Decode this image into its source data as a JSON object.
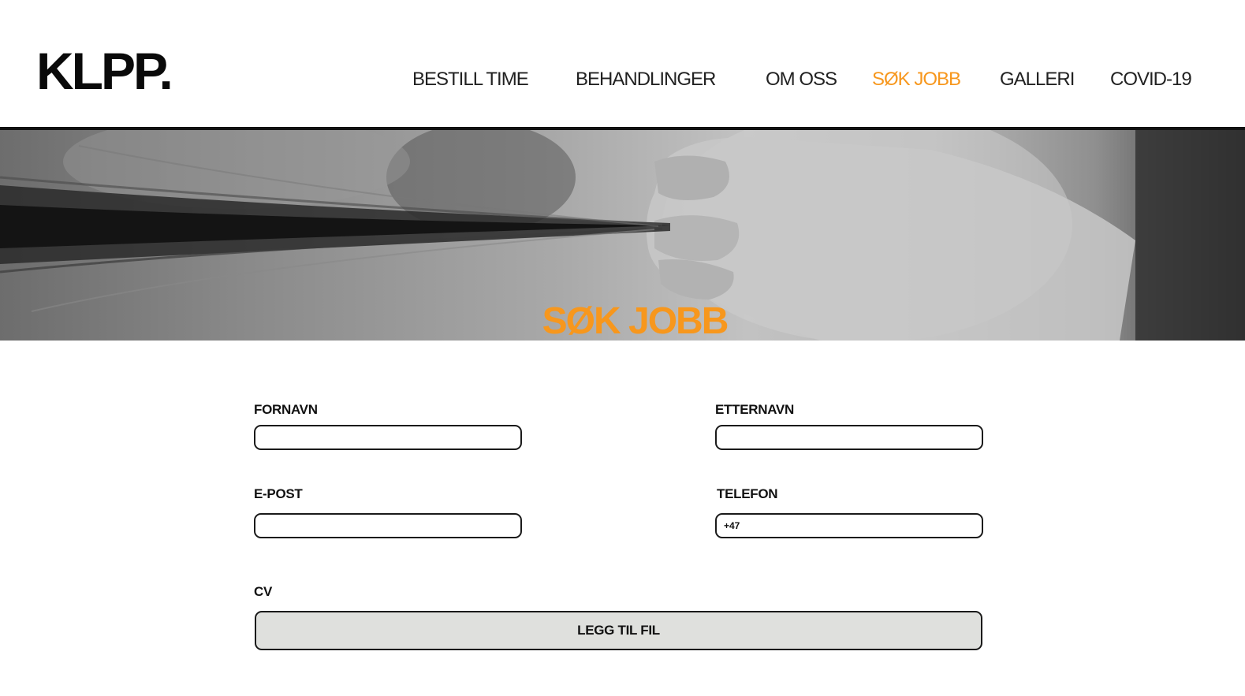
{
  "header": {
    "logo": "KLPP.",
    "nav": [
      {
        "label": "BESTILL TIME",
        "active": false
      },
      {
        "label": "BEHANDLINGER",
        "active": false
      },
      {
        "label": "OM OSS",
        "active": false
      },
      {
        "label": "SØK JOBB",
        "active": true
      },
      {
        "label": "GALLERI",
        "active": false
      },
      {
        "label": "COVID-19",
        "active": false
      }
    ]
  },
  "hero": {
    "title": "SØK JOBB"
  },
  "form": {
    "first_name": {
      "label": "FORNAVN",
      "value": ""
    },
    "last_name": {
      "label": "ETTERNAVN",
      "value": ""
    },
    "email": {
      "label": "E-POST",
      "value": ""
    },
    "phone": {
      "label": "TELEFON",
      "value": "+47"
    },
    "cv": {
      "label": "CV",
      "button_label": "LEGG TIL FIL"
    }
  },
  "colors": {
    "accent": "#f7971d",
    "text": "#111111",
    "button_bg": "#dfe0dd"
  }
}
